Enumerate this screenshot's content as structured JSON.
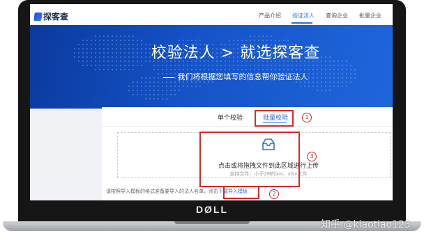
{
  "site": {
    "logo_text": "探客查",
    "nav": [
      {
        "label": "产品介绍",
        "active": false
      },
      {
        "label": "验证法人",
        "active": true
      },
      {
        "label": "查询企业",
        "active": false
      },
      {
        "label": "批量企业",
        "active": false
      }
    ]
  },
  "hero": {
    "title": "校验法人 > 就选探客查",
    "subtitle": "我们将根据您填写的信息帮你验证法人"
  },
  "card": {
    "tabs": [
      {
        "label": "单个校验",
        "active": false
      },
      {
        "label": "批量校验",
        "active": true
      }
    ],
    "upload": {
      "icon": "inbox-upload-icon",
      "prompt": "点击或将拖拽文件到此区域进行上传",
      "support": "支持文件：小于2M的xls、xlsx文件"
    },
    "hint": {
      "text": "请按照导入模板的格式准备要导入的法人名单，点击",
      "link": "下载导入模板"
    }
  },
  "annotations": [
    "1",
    "2",
    "3"
  ],
  "laptop": {
    "brand": "DØLL"
  },
  "watermark": "知乎 @kiaotiao123",
  "colors": {
    "accent": "#2f6be0",
    "hero": "#1553c8",
    "annotation": "#d42a2a"
  }
}
